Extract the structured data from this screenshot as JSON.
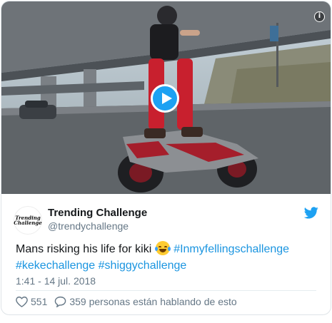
{
  "media": {
    "play_icon": "play-icon",
    "info_icon": "info-icon",
    "info_glyph": "i"
  },
  "author": {
    "avatar_line1": "Trending",
    "avatar_line2": "Challenge",
    "name": "Trending Challenge",
    "handle": "@trendychallenge"
  },
  "brand": {
    "logo_icon": "twitter-bird-icon",
    "color": "#1da1f2"
  },
  "tweet": {
    "text": "Mans risking his life for kiki",
    "emoji_icon": "face-with-tears-of-joy-icon",
    "hashtags": [
      "#Inmyfellingschallenge",
      "#kekechallenge",
      "#shiggychallenge"
    ],
    "timestamp": "1:41 - 14 jul. 2018",
    "hashtag_color": "#1b95e0"
  },
  "actions": {
    "likes": "551",
    "conversation": "359 personas están hablando de esto"
  }
}
